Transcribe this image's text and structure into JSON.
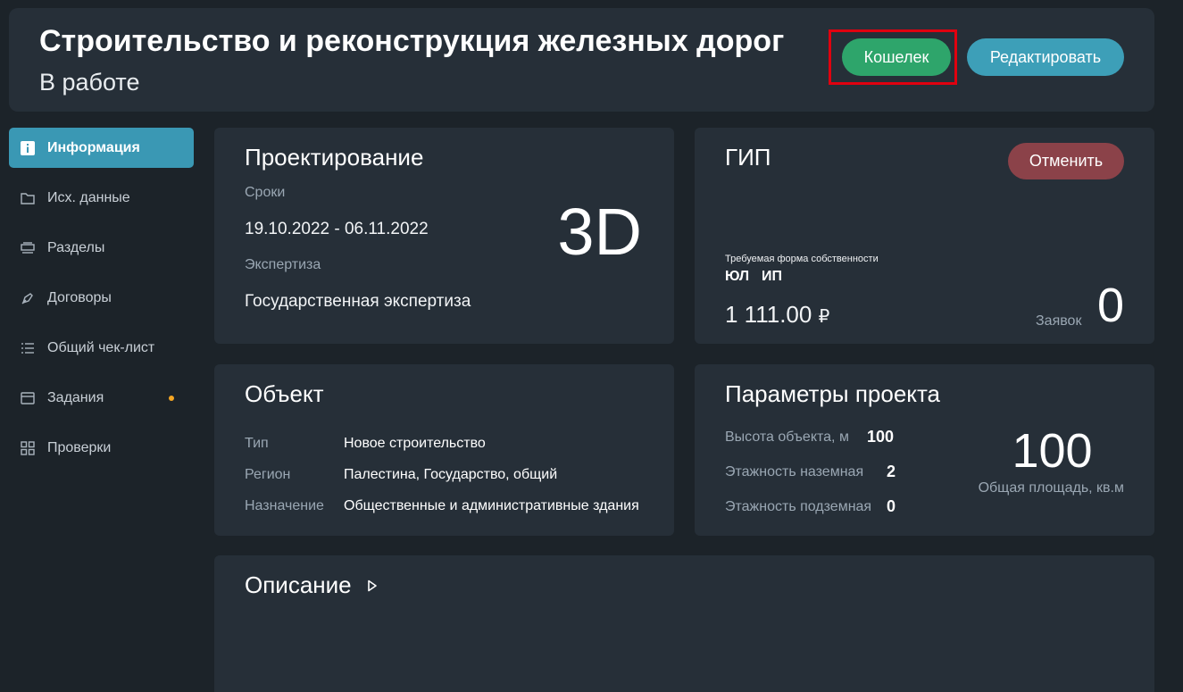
{
  "header": {
    "title": "Строительство и реконструкция железных дорог",
    "status": "В работе",
    "wallet_label": "Кошелек",
    "edit_label": "Редактировать"
  },
  "sidebar": {
    "items": [
      {
        "label": "Информация",
        "icon": "info-icon",
        "active": true
      },
      {
        "label": "Исх. данные",
        "icon": "folder-icon"
      },
      {
        "label": "Разделы",
        "icon": "sections-icon"
      },
      {
        "label": "Договоры",
        "icon": "pen-icon"
      },
      {
        "label": "Общий чек-лист",
        "icon": "checklist-icon"
      },
      {
        "label": "Задания",
        "icon": "tasks-icon",
        "badge_color": "#f5a623"
      },
      {
        "label": "Проверки",
        "icon": "grid-icon"
      }
    ]
  },
  "design": {
    "title": "Проектирование",
    "dates_label": "Сроки",
    "dates_value": "19.10.2022 - 06.11.2022",
    "expertise_label": "Экспертиза",
    "expertise_value": "Государственная экспертиза",
    "mode": "3D"
  },
  "gip": {
    "title": "ГИП",
    "cancel_label": "Отменить",
    "ownership_label": "Требуемая форма собственности",
    "ownership_options": [
      "ЮЛ",
      "ИП"
    ],
    "price": "1 111.00",
    "currency": "₽",
    "requests_label": "Заявок",
    "requests_count": "0"
  },
  "object": {
    "title": "Объект",
    "rows": [
      {
        "label": "Тип",
        "value": "Новое строительство"
      },
      {
        "label": "Регион",
        "value": "Палестина, Государство, общий"
      },
      {
        "label": "Назначение",
        "value": "Общественные и административные здания"
      }
    ]
  },
  "params": {
    "title": "Параметры проекта",
    "rows": [
      {
        "label": "Высота объекта, м",
        "value": "100"
      },
      {
        "label": "Этажность наземная",
        "value": "2"
      },
      {
        "label": "Этажность подземная",
        "value": "0"
      }
    ],
    "area_value": "100",
    "area_label": "Общая площадь, кв.м"
  },
  "description": {
    "title": "Описание"
  },
  "colors": {
    "background": "#1c2329",
    "card": "#262f38",
    "accent_blue": "#3a98b4",
    "wallet_green": "#2ea56b",
    "cancel_red": "#8b4249",
    "highlight_red": "#e0000f",
    "badge_orange": "#f5a623"
  }
}
